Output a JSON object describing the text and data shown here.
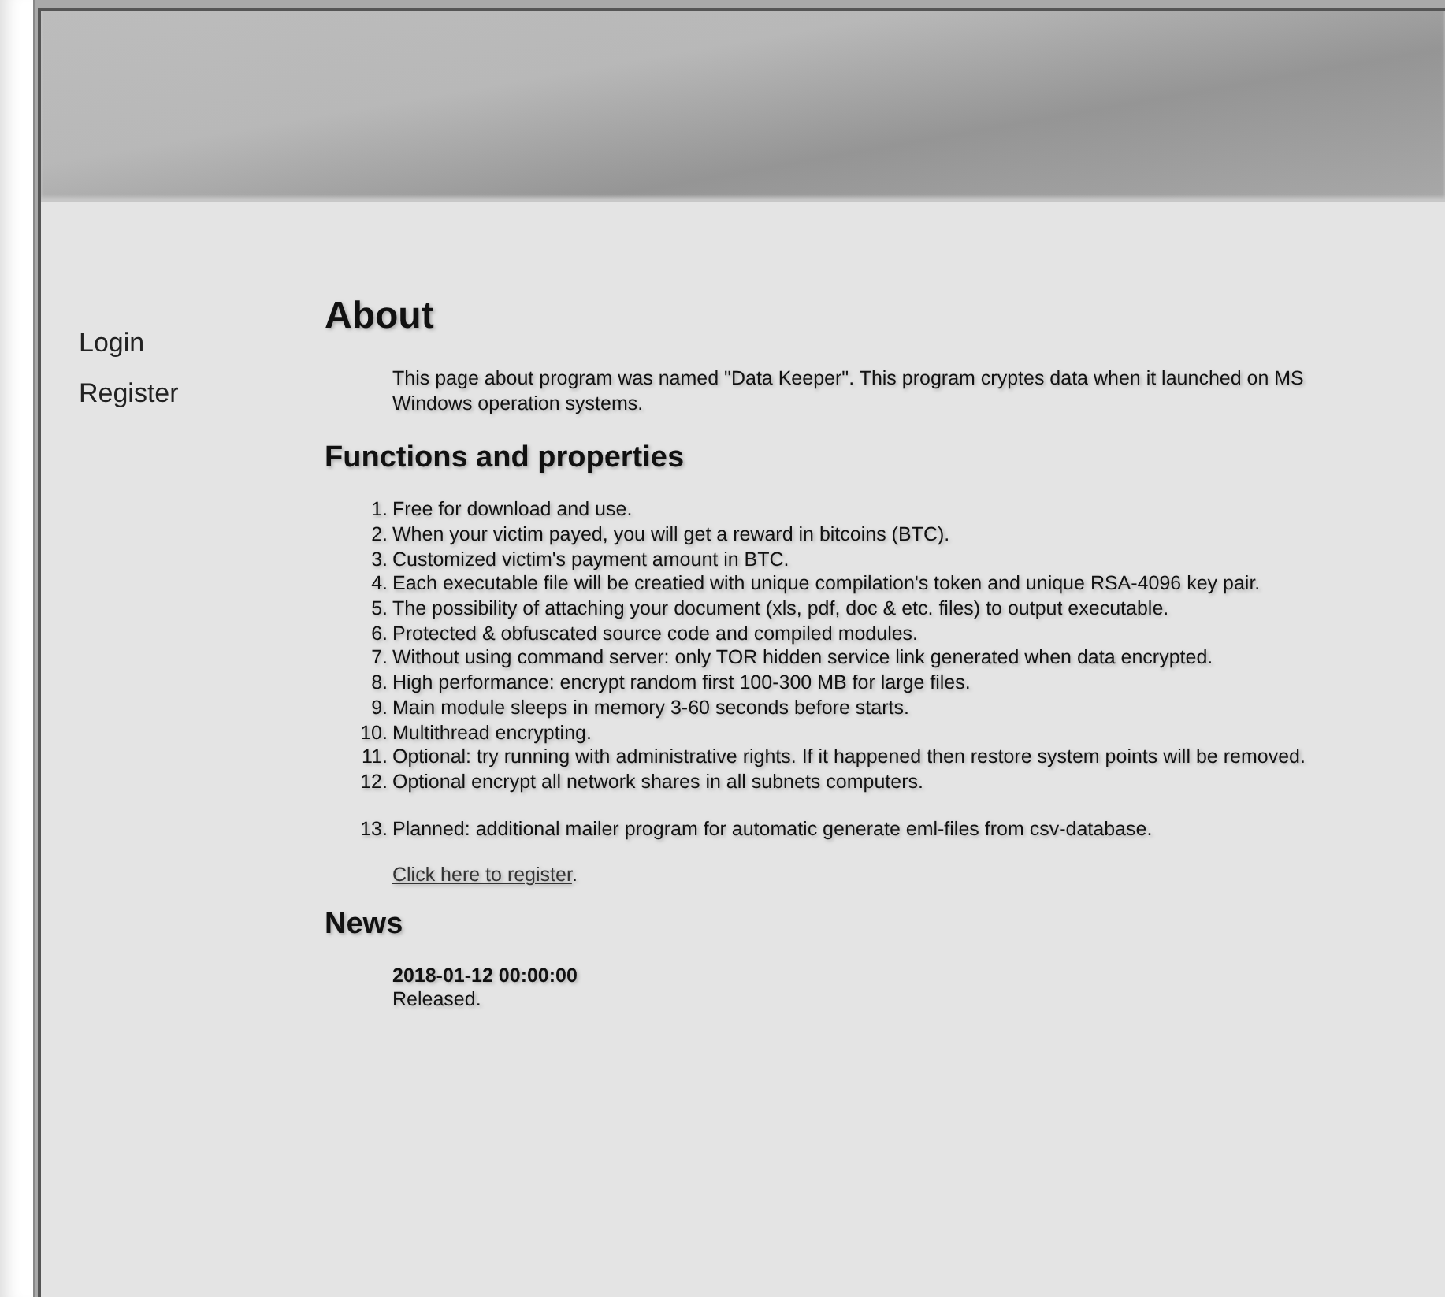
{
  "sidebar": {
    "items": [
      {
        "label": "Login"
      },
      {
        "label": "Register"
      }
    ]
  },
  "about": {
    "title": "About",
    "text": "This page about program was named \"Data Keeper\". This program cryptes data when it launched on MS Windows operation systems."
  },
  "functions": {
    "title": "Functions and properties",
    "items": [
      {
        "number": "1.",
        "text": "Free for download and use."
      },
      {
        "number": "2.",
        "text": "When your victim payed, you will get a reward in bitcoins (BTC)."
      },
      {
        "number": "3.",
        "text": "Customized victim's payment amount in BTC."
      },
      {
        "number": "4.",
        "text": "Each executable file will be creatied with unique compilation's token and unique RSA-4096 key pair."
      },
      {
        "number": "5.",
        "text": "The possibility of attaching your document (xls, pdf, doc & etc. files) to output executable."
      },
      {
        "number": "6.",
        "text": "Protected & obfuscated source code and compiled modules."
      },
      {
        "number": "7.",
        "text": "Without using command server: only TOR hidden service link generated when data encrypted."
      },
      {
        "number": "8.",
        "text": "High performance: encrypt random first 100-300 MB for large files."
      },
      {
        "number": "9.",
        "text": "Main module sleeps in memory 3-60 seconds before starts."
      },
      {
        "number": "10.",
        "text": "Multithread encrypting."
      },
      {
        "number": "11.",
        "text": "Optional: try running with administrative rights. If it happened then restore system points will be removed."
      },
      {
        "number": "12.",
        "text": "Optional encrypt all network shares in all subnets computers."
      }
    ],
    "planned": [
      {
        "number": "13.",
        "text": "Planned: additional mailer program for automatic generate eml-files from csv-database."
      }
    ],
    "link": "Click here to register",
    "link_suffix": "."
  },
  "news": {
    "title": "News",
    "items": [
      {
        "date": "2018-01-12 00:00:00",
        "text": "Released."
      }
    ]
  }
}
